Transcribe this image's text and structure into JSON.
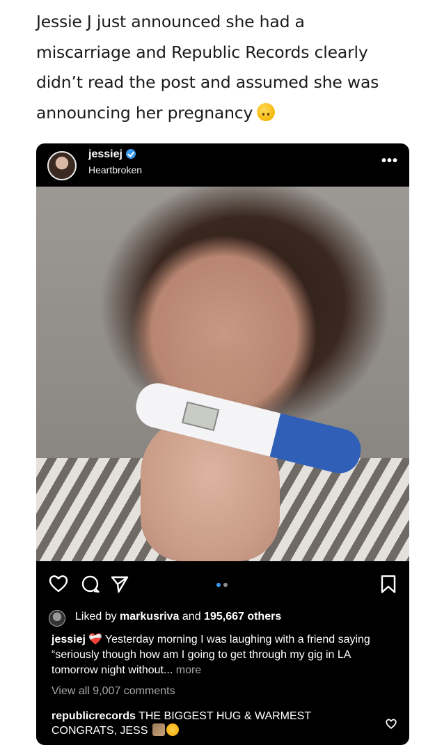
{
  "tweet": {
    "line1": "Jessie J just announced she had a",
    "line2": "miscarriage and Republic Records clearly",
    "line3": "didn’t read the post and assumed she was",
    "line4": "announcing her pregnancy",
    "emoji_icon": "upside-down-face-emoji"
  },
  "post": {
    "username": "jessiej",
    "subtitle": "Heartbroken",
    "more_icon": "more-options-icon",
    "actions": {
      "like_icon": "heart-icon",
      "comment_icon": "comment-icon",
      "share_icon": "send-icon",
      "save_icon": "bookmark-icon"
    },
    "carousel": {
      "count": 2,
      "active": 1
    },
    "likes": {
      "prefix": "Liked by",
      "user": "markusriva",
      "middle": "and",
      "others": "195,667 others"
    },
    "caption": {
      "username": "jessiej",
      "emoji": "❤️‍🩹",
      "text": "Yesterday morning I was laughing with a friend saying “seriously though how am I going to get through my gig in LA tomorrow night without...",
      "more": "more"
    },
    "view_comments": "View all 9,007 comments",
    "comment": {
      "username": "republicrecords",
      "text": "THE BIGGEST HUG & WARMEST CONGRATS, JESS"
    },
    "colors": {
      "background": "#000000",
      "verified": "#3897f0",
      "muted_text": "#a8a8a8",
      "active_dot": "#3897f0"
    }
  }
}
